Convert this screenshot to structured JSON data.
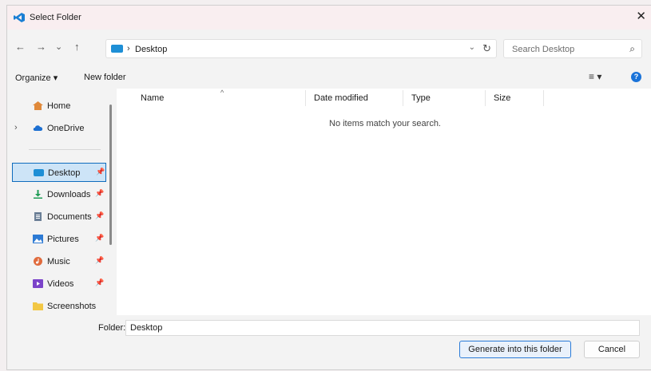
{
  "window": {
    "title": "Select Folder"
  },
  "icons": {
    "app": "vscode-icon",
    "close": "close-icon",
    "back": "back-arrow-icon",
    "forward": "forward-arrow-icon",
    "recent": "chevron-down-icon",
    "up": "up-arrow-icon",
    "refresh": "refresh-icon",
    "search": "search-icon",
    "help": "help-icon"
  },
  "nav": {
    "back": "←",
    "forward": "→",
    "recent": "⌄",
    "up": "↑",
    "breadcrumb_sep": "›",
    "breadcrumb": "Desktop",
    "address_dropdown": "⌄",
    "refresh": "↻",
    "search_placeholder": "Search Desktop",
    "search_glyph": "⌕"
  },
  "toolbar": {
    "organize": "Organize ▾",
    "new_folder": "New folder",
    "view": "≡ ▾",
    "help": "?"
  },
  "sidebar": {
    "items": [
      {
        "label": "Home",
        "icon": "home-icon",
        "color": "#e0893a"
      },
      {
        "label": "OneDrive",
        "icon": "cloud-icon",
        "color": "#1c6fd1",
        "expander": "›"
      },
      {
        "label": "Desktop",
        "icon": "desktop-icon",
        "color": "#1e8fd6",
        "pin": "📌",
        "selected": true
      },
      {
        "label": "Downloads",
        "icon": "download-icon",
        "color": "#1f9b55",
        "pin": "📌"
      },
      {
        "label": "Documents",
        "icon": "document-icon",
        "color": "#6b7f96",
        "pin": "📌"
      },
      {
        "label": "Pictures",
        "icon": "pictures-icon",
        "color": "#2d7ad4",
        "pin": "📌"
      },
      {
        "label": "Music",
        "icon": "music-icon",
        "color": "#e06b3d",
        "pin": "📌"
      },
      {
        "label": "Videos",
        "icon": "videos-icon",
        "color": "#7b43c9",
        "pin": "📌"
      },
      {
        "label": "Screenshots",
        "icon": "folder-icon",
        "color": "#f2c744"
      }
    ]
  },
  "filelist": {
    "columns": [
      "Name",
      "Date modified",
      "Type",
      "Size"
    ],
    "sort_glyph": "^",
    "empty_message": "No items match your search."
  },
  "footer": {
    "folder_label": "Folder:",
    "folder_value": "Desktop",
    "primary_button": "Generate into this folder",
    "cancel_button": "Cancel"
  }
}
